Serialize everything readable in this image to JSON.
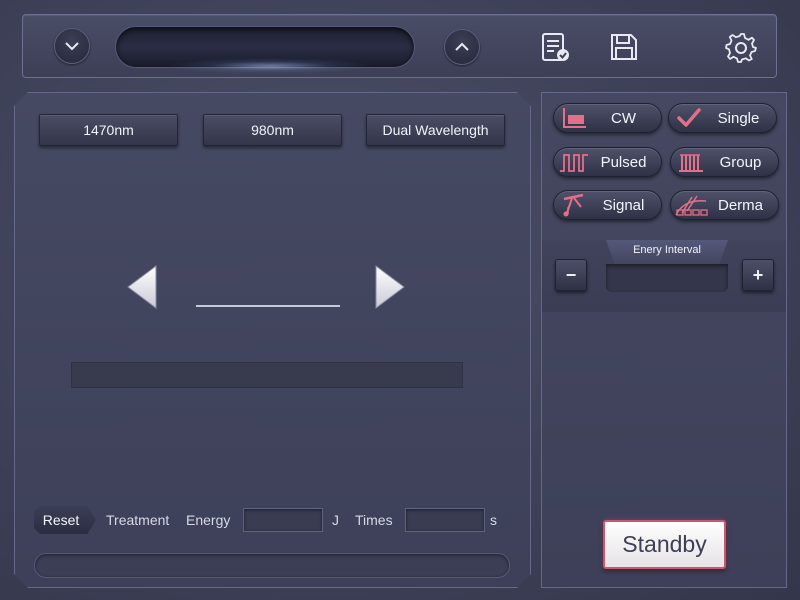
{
  "topbar": {
    "down_icon": "chevron-down-icon",
    "up_icon": "chevron-up-icon",
    "report_icon": "report-check-icon",
    "save_icon": "floppy-save-icon",
    "settings_icon": "gear-icon"
  },
  "wavelengths": [
    {
      "label": "1470nm"
    },
    {
      "label": "980nm"
    },
    {
      "label": "Dual Wavelength"
    }
  ],
  "bottom": {
    "reset_label": "Reset",
    "treatment_label": "Treatment",
    "energy_label": "Energy",
    "energy_unit": "J",
    "times_label": "Times",
    "times_unit": "s"
  },
  "modes": [
    {
      "label": "CW",
      "icon": "cw-chart-icon"
    },
    {
      "label": "Single",
      "icon": "checkmark-icon"
    },
    {
      "label": "Pulsed",
      "icon": "pulse-wave-icon"
    },
    {
      "label": "Group",
      "icon": "group-bars-icon"
    },
    {
      "label": "Signal",
      "icon": "signal-music-icon"
    },
    {
      "label": "Derma",
      "icon": "derma-icon"
    }
  ],
  "energy_interval": {
    "title": "Enery Interval",
    "minus_label": "−",
    "plus_label": "+"
  },
  "standby_label": "Standby",
  "colors": {
    "accent_pink": "#e27088",
    "background": "#3e4158"
  }
}
